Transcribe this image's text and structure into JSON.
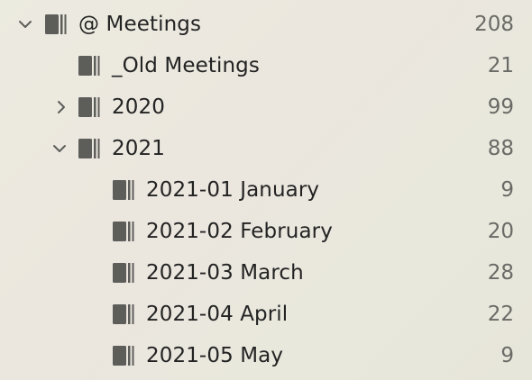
{
  "outline": {
    "items": [
      {
        "label": "@ Meetings",
        "count": "208",
        "chevron": "chevron-down-icon",
        "icon": "notebook-icon"
      },
      {
        "label": "_Old Meetings",
        "count": "21",
        "chevron": "",
        "icon": "notebook-icon"
      },
      {
        "label": "2020",
        "count": "99",
        "chevron": "chevron-right-icon",
        "icon": "notebook-icon"
      },
      {
        "label": "2021",
        "count": "88",
        "chevron": "chevron-down-icon",
        "icon": "notebook-icon"
      },
      {
        "label": "2021-01 January",
        "count": "9",
        "chevron": "",
        "icon": "notebook-icon"
      },
      {
        "label": "2021-02 February",
        "count": "20",
        "chevron": "",
        "icon": "notebook-icon"
      },
      {
        "label": "2021-03 March",
        "count": "28",
        "chevron": "",
        "icon": "notebook-icon"
      },
      {
        "label": "2021-04 April",
        "count": "22",
        "chevron": "",
        "icon": "notebook-icon"
      },
      {
        "label": "2021-05 May",
        "count": "9",
        "chevron": "",
        "icon": "notebook-icon"
      }
    ]
  },
  "colors": {
    "icon": "#5d5d5a",
    "text": "#232323",
    "count": "#6a6a66"
  }
}
